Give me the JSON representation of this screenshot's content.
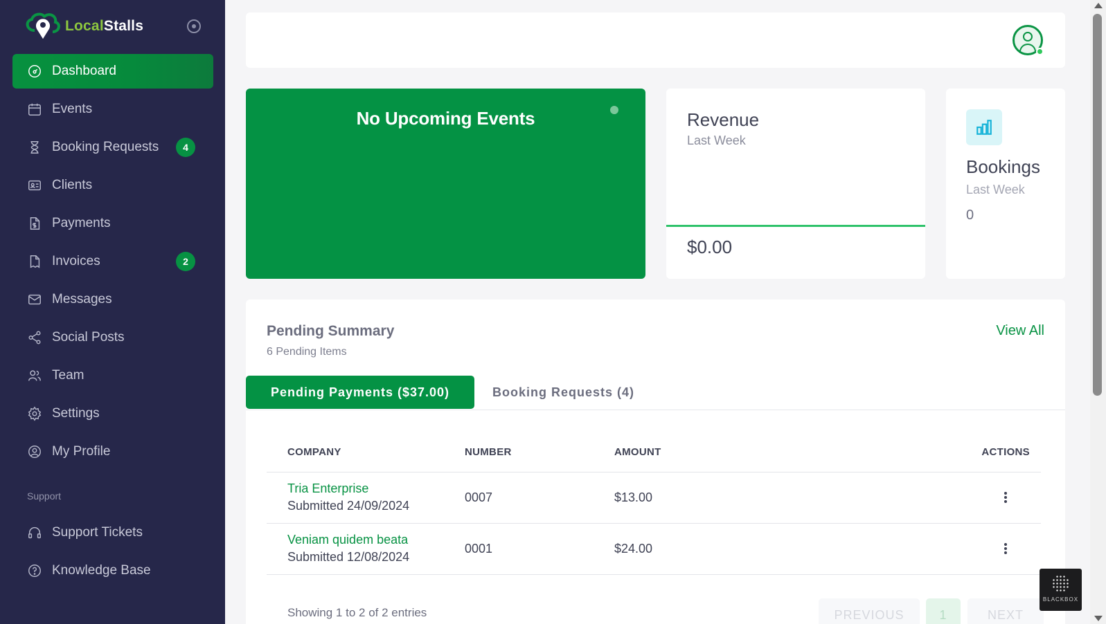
{
  "brand": {
    "name_part1": "Local",
    "name_part2": "Stalls"
  },
  "sidebar": {
    "items": [
      {
        "label": "Dashboard",
        "icon": "dashboard-icon",
        "active": true
      },
      {
        "label": "Events",
        "icon": "calendar-icon"
      },
      {
        "label": "Booking Requests",
        "icon": "hourglass-icon",
        "badge": "4"
      },
      {
        "label": "Clients",
        "icon": "id-card-icon"
      },
      {
        "label": "Payments",
        "icon": "dollar-document-icon"
      },
      {
        "label": "Invoices",
        "icon": "receipt-icon",
        "badge": "2"
      },
      {
        "label": "Messages",
        "icon": "envelope-icon"
      },
      {
        "label": "Social Posts",
        "icon": "share-icon"
      },
      {
        "label": "Team",
        "icon": "users-icon"
      },
      {
        "label": "Settings",
        "icon": "gear-icon"
      },
      {
        "label": "My Profile",
        "icon": "user-circle-icon"
      }
    ],
    "support_label": "Support",
    "support_items": [
      {
        "label": "Support Tickets",
        "icon": "headset-icon"
      },
      {
        "label": "Knowledge Base",
        "icon": "question-circle-icon"
      }
    ]
  },
  "events_card": {
    "title": "No Upcoming Events"
  },
  "revenue_card": {
    "title": "Revenue",
    "subtitle": "Last Week",
    "value": "$0.00"
  },
  "bookings_card": {
    "title": "Bookings",
    "subtitle": "Last Week",
    "value": "0"
  },
  "pending": {
    "title": "Pending Summary",
    "subtitle": "6 Pending Items",
    "view_all": "View All",
    "tabs": [
      {
        "label": "Pending Payments ($37.00)",
        "active": true
      },
      {
        "label": "Booking Requests (4)",
        "active": false
      }
    ],
    "columns": [
      "COMPANY",
      "NUMBER",
      "AMOUNT",
      "ACTIONS"
    ],
    "rows": [
      {
        "company": "Tria Enterprise",
        "submitted": "Submitted 24/09/2024",
        "number": "0007",
        "amount": "$13.00"
      },
      {
        "company": "Veniam quidem beata",
        "submitted": "Submitted 12/08/2024",
        "number": "0001",
        "amount": "$24.00"
      }
    ],
    "showing": "Showing 1 to 2 of 2 entries",
    "pager": {
      "prev": "PREVIOUS",
      "page": "1",
      "next": "NEXT"
    }
  },
  "watermark": {
    "text": "BLACKBOX"
  },
  "colors": {
    "sidebar_bg": "#26274a",
    "accent_green": "#049244",
    "revenue_line": "#2fc26b",
    "bookings_icon": "#16b3d8"
  }
}
